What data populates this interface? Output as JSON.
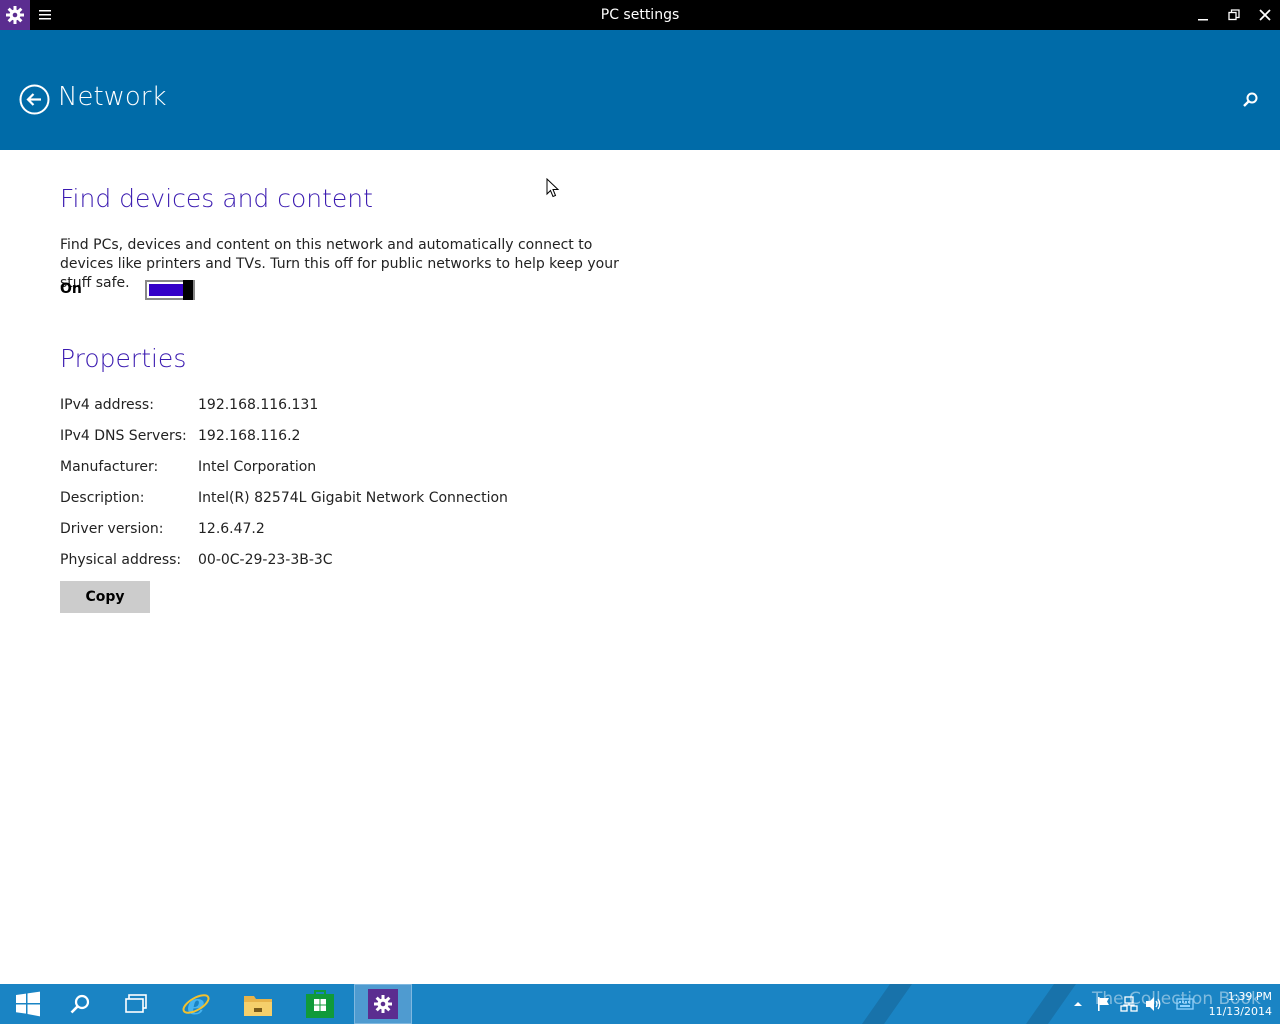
{
  "window": {
    "title": "PC settings"
  },
  "header": {
    "title": "Network"
  },
  "find_devices": {
    "heading": "Find devices and content",
    "description": "Find PCs, devices and content on this network and automatically connect to devices like printers and TVs. Turn this off for public networks to help keep your stuff safe.",
    "toggle_label": "On",
    "toggle_state": "on"
  },
  "properties": {
    "heading": "Properties",
    "rows": [
      {
        "label": "IPv4 address:",
        "value": "192.168.116.131"
      },
      {
        "label": "IPv4 DNS Servers:",
        "value": "192.168.116.2"
      },
      {
        "label": "Manufacturer:",
        "value": "Intel Corporation"
      },
      {
        "label": "Description:",
        "value": "Intel(R) 82574L Gigabit Network Connection"
      },
      {
        "label": "Driver version:",
        "value": "12.6.47.2"
      },
      {
        "label": "Physical address:",
        "value": "00-0C-29-23-3B-3C"
      }
    ],
    "copy_label": "Copy"
  },
  "taskbar": {
    "time": "1:39 PM",
    "date": "11/13/2014",
    "watermark": "The Collection Book",
    "apps": [
      "start-icon",
      "search-icon",
      "task-view-icon",
      "internet-explorer-icon",
      "file-explorer-icon",
      "store-icon",
      "settings-icon"
    ]
  },
  "colors": {
    "header": "#006ba8",
    "accent": "#3a1ab0",
    "taskbar": "#1a84c4"
  }
}
